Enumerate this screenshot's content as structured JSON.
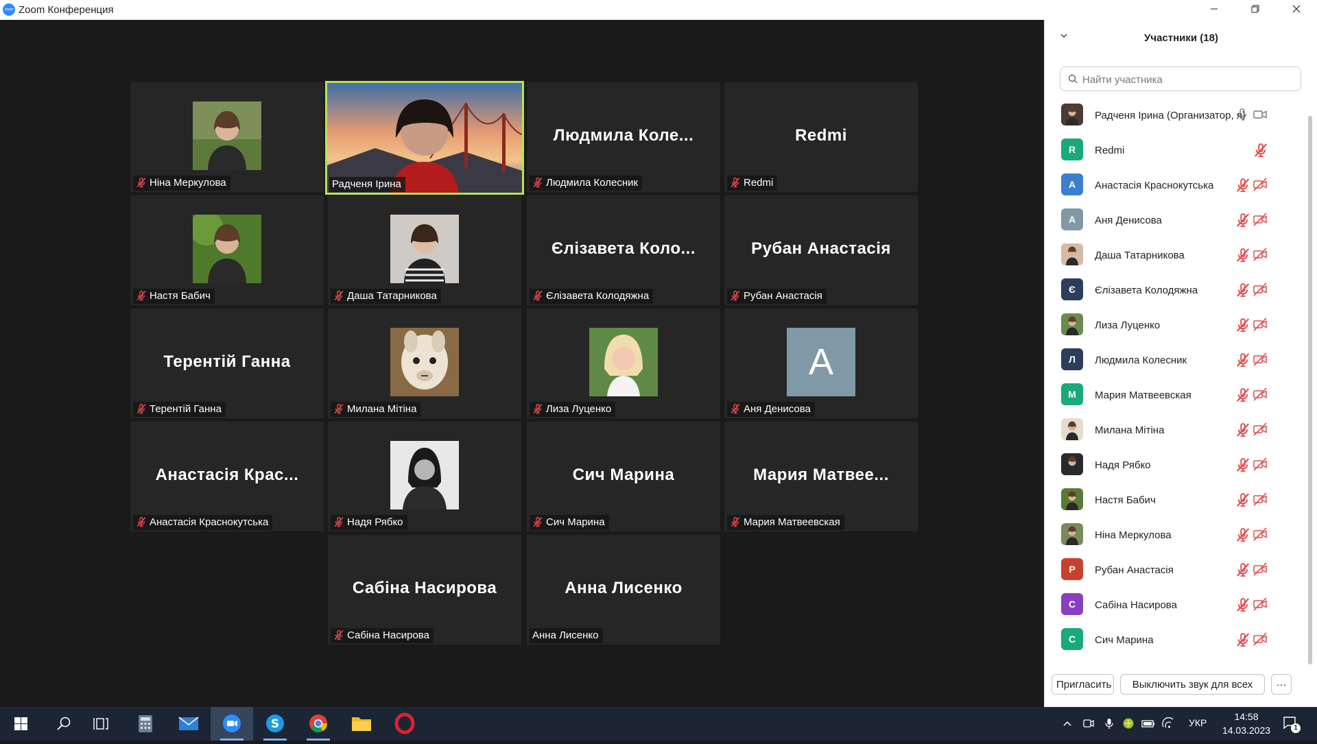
{
  "window": {
    "title": "Zoom Конференция",
    "app_icon_text": "zoom",
    "buttons": [
      "minimize",
      "restore",
      "close"
    ]
  },
  "gallery": {
    "active_speaker": "Радченя Ірина",
    "tiles": [
      {
        "id": "nina",
        "label": "Ніна Меркулова",
        "muted": true,
        "display": "photo",
        "icon": "person-photo-avatar"
      },
      {
        "id": "radchenia",
        "label": "Радченя Ірина",
        "muted": false,
        "display": "video",
        "icon": "video-feed-golden-gate"
      },
      {
        "id": "liudmyla",
        "label": "Людмила Колесник",
        "big_name": "Людмила  Коле...",
        "muted": true,
        "display": "name"
      },
      {
        "id": "redmi",
        "label": "Redmi",
        "big_name": "Redmi",
        "muted": true,
        "display": "name"
      },
      {
        "id": "nastia",
        "label": "Настя Бабич",
        "muted": true,
        "display": "photo",
        "icon": "person-photo-avatar"
      },
      {
        "id": "dasha",
        "label": "Даша Татарникова",
        "muted": true,
        "display": "photo",
        "icon": "person-photo-avatar"
      },
      {
        "id": "yelyzaveta",
        "label": "Єлізавета Колодяжна",
        "big_name": "Єлізавета  Коло...",
        "muted": true,
        "display": "name"
      },
      {
        "id": "ruban",
        "label": "Рубан Анастасія",
        "big_name": "Рубан Анастасія",
        "muted": true,
        "display": "name"
      },
      {
        "id": "terentii",
        "label": "Терентій Ганна",
        "big_name": "Терентій Ганна",
        "muted": true,
        "display": "name"
      },
      {
        "id": "mylana",
        "label": "Милана Мітіна",
        "muted": true,
        "display": "photo",
        "icon": "llama-photo-avatar"
      },
      {
        "id": "lyza",
        "label": "Лиза Луценко",
        "muted": true,
        "display": "photo",
        "icon": "person-photo-avatar"
      },
      {
        "id": "ania",
        "label": "Аня Денисова",
        "letter": "A",
        "muted": true,
        "display": "letter"
      },
      {
        "id": "anastasiia",
        "label": "Анастасія Краснокутська",
        "big_name": "Анастасія  Крас...",
        "muted": true,
        "display": "name"
      },
      {
        "id": "nadia",
        "label": "Надя Рябко",
        "muted": true,
        "display": "photo",
        "icon": "person-photo-avatar"
      },
      {
        "id": "sych",
        "label": "Сич Марина",
        "big_name": "Сич Марина",
        "muted": true,
        "display": "name"
      },
      {
        "id": "maria",
        "label": "Мария Матвеевская",
        "big_name": "Мария  Матвее...",
        "muted": true,
        "display": "name"
      },
      {
        "id": "sabina",
        "label": "Сабіна Насирова",
        "big_name": "Сабіна Насирова",
        "muted": true,
        "display": "name"
      },
      {
        "id": "anna",
        "label": "Анна Лисенко",
        "big_name": "Анна Лисенко",
        "muted": false,
        "display": "name"
      }
    ]
  },
  "participants_panel": {
    "title": "Участники (18)",
    "search_placeholder": "Найти участника",
    "list": [
      {
        "name": "Радченя Ірина (Организатор, я)",
        "avatar": "photo",
        "mic": "on",
        "video": "on"
      },
      {
        "name": "Redmi",
        "avatar": "letter",
        "letter": "R",
        "color": "#1aa97b",
        "mic": "muted",
        "video": "none"
      },
      {
        "name": "Анастасія Краснокутська",
        "avatar": "letter",
        "letter": "А",
        "color": "#3b7fd1",
        "mic": "muted",
        "video": "off"
      },
      {
        "name": "Аня Денисова",
        "avatar": "letter",
        "letter": "A",
        "color": "#7f99a6",
        "mic": "muted",
        "video": "off"
      },
      {
        "name": "Даша Татарникова",
        "avatar": "photo",
        "mic": "muted",
        "video": "off"
      },
      {
        "name": "Єлізавета Колодяжна",
        "avatar": "letter",
        "letter": "Є",
        "color": "#2c3e5c",
        "mic": "muted",
        "video": "off"
      },
      {
        "name": "Лиза Луценко",
        "avatar": "photo",
        "mic": "muted",
        "video": "off"
      },
      {
        "name": "Людмила Колесник",
        "avatar": "letter",
        "letter": "Л",
        "color": "#2c3e5c",
        "mic": "muted",
        "video": "off"
      },
      {
        "name": "Мария Матвеевская",
        "avatar": "letter",
        "letter": "М",
        "color": "#1aa97b",
        "mic": "muted",
        "video": "off"
      },
      {
        "name": "Милана Мітіна",
        "avatar": "photo",
        "mic": "muted",
        "video": "off"
      },
      {
        "name": "Надя Рябко",
        "avatar": "photo",
        "mic": "muted",
        "video": "off"
      },
      {
        "name": "Настя Бабич",
        "avatar": "photo",
        "mic": "muted",
        "video": "off"
      },
      {
        "name": "Ніна Меркулова",
        "avatar": "photo",
        "mic": "muted",
        "video": "off"
      },
      {
        "name": "Рубан Анастасія",
        "avatar": "letter",
        "letter": "Р",
        "color": "#c8412f",
        "mic": "muted",
        "video": "off"
      },
      {
        "name": "Сабіна Насирова",
        "avatar": "letter",
        "letter": "С",
        "color": "#8a3fc0",
        "mic": "muted",
        "video": "off"
      },
      {
        "name": "Сич Марина",
        "avatar": "letter",
        "letter": "С",
        "color": "#1aa97b",
        "mic": "muted",
        "video": "off"
      }
    ],
    "invite_label": "Пригласить",
    "mute_all_label": "Выключить звук для всех",
    "more_label": "···"
  },
  "taskbar": {
    "apps": [
      "windows-start-icon",
      "search-icon",
      "task-view-icon",
      "calculator-icon",
      "mail-icon",
      "zoom-icon",
      "skype-icon",
      "chrome-icon",
      "file-explorer-icon",
      "opera-icon"
    ],
    "language": "УКР",
    "time": "14:58",
    "date": "14.03.2023",
    "notification_count": "1"
  },
  "colors": {
    "active_speaker_border": "#b6e35a",
    "muted_red": "#e24c4c",
    "taskbar_bg": "#1b2534"
  }
}
